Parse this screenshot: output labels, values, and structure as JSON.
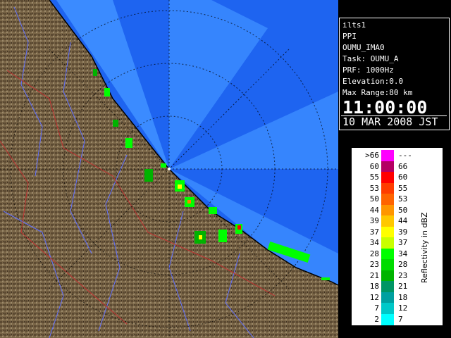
{
  "radar_view": {
    "sea_color": "#1e64f0",
    "sector_color": "#3b8bff",
    "land_color": "#7a6648",
    "echo_colors": [
      "#00b300",
      "#00ff00",
      "#ffff00",
      "#ff8000",
      "#ff0000",
      "#0000ff"
    ]
  },
  "info": {
    "lines": [
      "ilts1",
      "PPI",
      "OUMU_IMA0",
      "Task: OUMU_A",
      "PRF: 1000Hz",
      "Elevation:0.0",
      "Max Range:80 km"
    ],
    "time": "11:00:00",
    "date": "10 MAR 2008 JST"
  },
  "legend": {
    "unit": "Reflectivity in dBZ",
    "rows": [
      {
        "lo": ">66",
        "hi": "---",
        "color": "#ff00ff"
      },
      {
        "lo": "60",
        "hi": "66",
        "color": "#b40064"
      },
      {
        "lo": "55",
        "hi": "60",
        "color": "#ff0000"
      },
      {
        "lo": "53",
        "hi": "55",
        "color": "#ff3c00"
      },
      {
        "lo": "50",
        "hi": "53",
        "color": "#ff6400"
      },
      {
        "lo": "44",
        "hi": "50",
        "color": "#ff9600"
      },
      {
        "lo": "39",
        "hi": "44",
        "color": "#ffc800"
      },
      {
        "lo": "37",
        "hi": "39",
        "color": "#ffff00"
      },
      {
        "lo": "34",
        "hi": "37",
        "color": "#c8ff00"
      },
      {
        "lo": "28",
        "hi": "34",
        "color": "#00ff00"
      },
      {
        "lo": "23",
        "hi": "28",
        "color": "#00dc00"
      },
      {
        "lo": "21",
        "hi": "23",
        "color": "#00b400"
      },
      {
        "lo": "18",
        "hi": "21",
        "color": "#009664"
      },
      {
        "lo": "12",
        "hi": "18",
        "color": "#00a0a0"
      },
      {
        "lo": "7",
        "hi": "12",
        "color": "#00c8c8"
      },
      {
        "lo": "2",
        "hi": "7",
        "color": "#00ffff"
      }
    ]
  }
}
